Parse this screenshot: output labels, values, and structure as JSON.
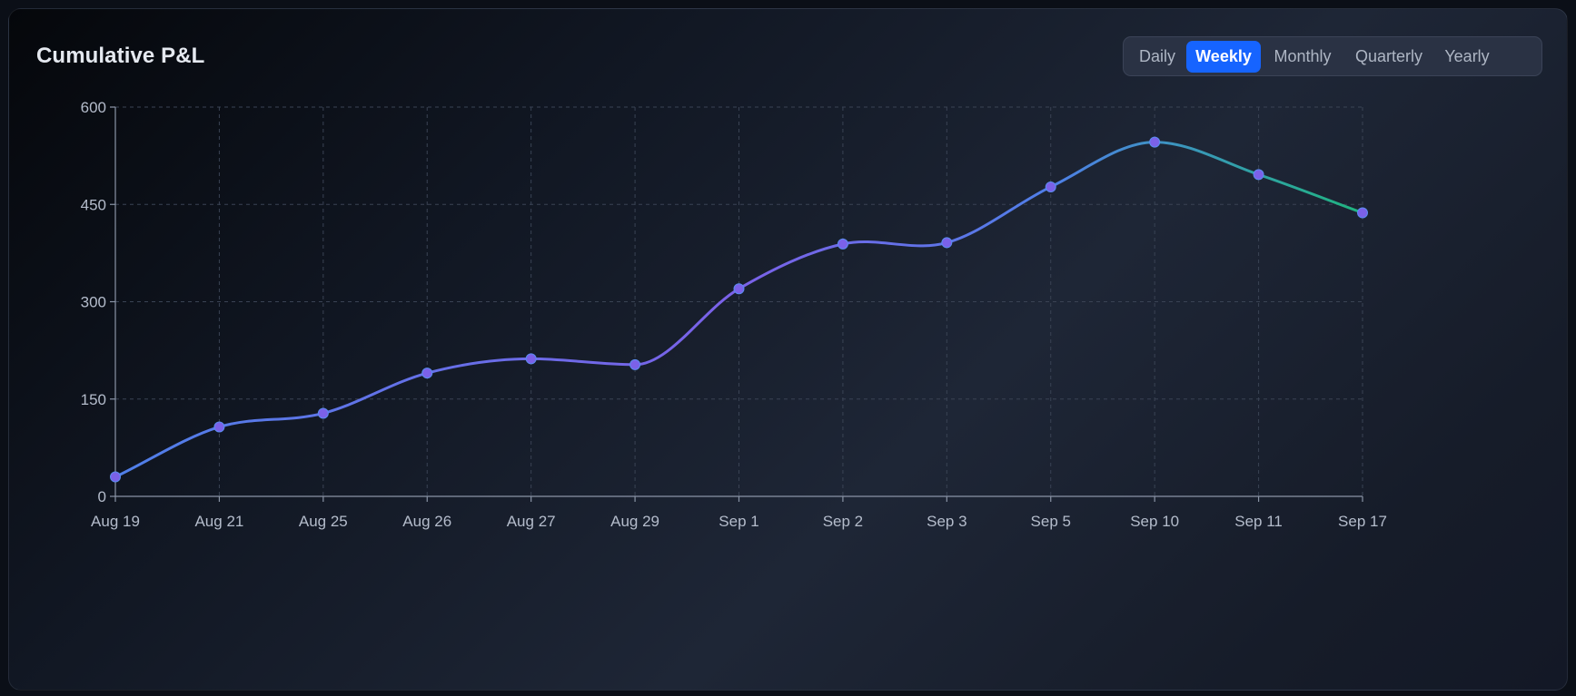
{
  "card": {
    "title": "Cumulative P&L"
  },
  "tabs": [
    {
      "label": "Daily",
      "active": false
    },
    {
      "label": "Weekly",
      "active": true
    },
    {
      "label": "Monthly",
      "active": false
    },
    {
      "label": "Quarterly",
      "active": false
    },
    {
      "label": "Yearly",
      "active": false
    }
  ],
  "colors": {
    "accent": "#1664ff",
    "line_start": "#4f7fe8",
    "line_mid": "#7b61e8",
    "line_end": "#1fb57f",
    "point": "#7b61e8"
  },
  "chart_data": {
    "type": "line",
    "title": "",
    "xlabel": "",
    "ylabel": "",
    "categories": [
      "Aug 19",
      "Aug 21",
      "Aug 25",
      "Aug 26",
      "Aug 27",
      "Aug 29",
      "Sep 1",
      "Sep 2",
      "Sep 3",
      "Sep 5",
      "Sep 10",
      "Sep 11",
      "Sep 17"
    ],
    "values": [
      30,
      107,
      128,
      190,
      212,
      203,
      320,
      389,
      391,
      477,
      546,
      496,
      437
    ],
    "ylim": [
      0,
      600
    ],
    "yticks": [
      0,
      150,
      300,
      450,
      600
    ],
    "grid": true,
    "curve": "smooth",
    "legend": "none"
  }
}
